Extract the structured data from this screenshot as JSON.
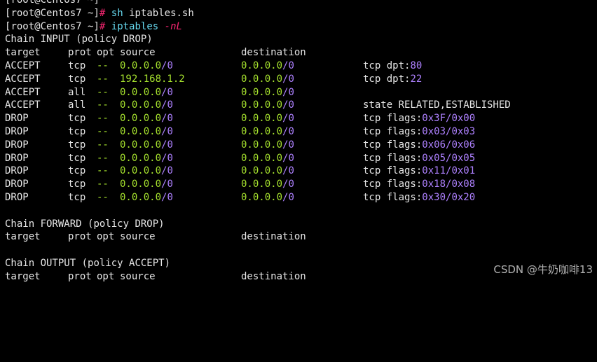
{
  "prompt1": {
    "open": "[",
    "userhost": "root@Centos7",
    "path": " ~",
    "close": "]",
    "hash": "#",
    "cmd": "sh",
    "arg": "iptables.sh"
  },
  "prompt2": {
    "open": "[",
    "userhost": "root@Centos7",
    "path": " ~",
    "close": "]",
    "hash": "#",
    "cmd": "iptables",
    "arg": "-nL"
  },
  "chains": {
    "input": {
      "title": "Chain INPUT",
      "policy": "(policy DROP)",
      "header": {
        "target": "target",
        "prot": "prot",
        "opt": "opt",
        "source": "source",
        "destination": "destination"
      },
      "rules": [
        {
          "target": "ACCEPT",
          "prot": "tcp",
          "opt": "--",
          "src_ip": "0.0.0.0",
          "src_mask": "/0",
          "dst_ip": "0.0.0.0",
          "dst_mask": "/0",
          "extra_a": "tcp dpt:",
          "extra_b": "80"
        },
        {
          "target": "ACCEPT",
          "prot": "tcp",
          "opt": "--",
          "src_ip": "192.168.1.2",
          "src_mask": "",
          "dst_ip": "0.0.0.0",
          "dst_mask": "/0",
          "extra_a": "tcp dpt:",
          "extra_b": "22"
        },
        {
          "target": "ACCEPT",
          "prot": "all",
          "opt": "--",
          "src_ip": "0.0.0.0",
          "src_mask": "/0",
          "dst_ip": "0.0.0.0",
          "dst_mask": "/0",
          "extra_a": "",
          "extra_b": ""
        },
        {
          "target": "ACCEPT",
          "prot": "all",
          "opt": "--",
          "src_ip": "0.0.0.0",
          "src_mask": "/0",
          "dst_ip": "0.0.0.0",
          "dst_mask": "/0",
          "extra_a": "state RELATED,ESTABLISHED",
          "extra_b": ""
        },
        {
          "target": "DROP",
          "prot": "tcp",
          "opt": "--",
          "src_ip": "0.0.0.0",
          "src_mask": "/0",
          "dst_ip": "0.0.0.0",
          "dst_mask": "/0",
          "extra_a": "tcp flags:",
          "extra_b": "0x3F/0x00"
        },
        {
          "target": "DROP",
          "prot": "tcp",
          "opt": "--",
          "src_ip": "0.0.0.0",
          "src_mask": "/0",
          "dst_ip": "0.0.0.0",
          "dst_mask": "/0",
          "extra_a": "tcp flags:",
          "extra_b": "0x03/0x03"
        },
        {
          "target": "DROP",
          "prot": "tcp",
          "opt": "--",
          "src_ip": "0.0.0.0",
          "src_mask": "/0",
          "dst_ip": "0.0.0.0",
          "dst_mask": "/0",
          "extra_a": "tcp flags:",
          "extra_b": "0x06/0x06"
        },
        {
          "target": "DROP",
          "prot": "tcp",
          "opt": "--",
          "src_ip": "0.0.0.0",
          "src_mask": "/0",
          "dst_ip": "0.0.0.0",
          "dst_mask": "/0",
          "extra_a": "tcp flags:",
          "extra_b": "0x05/0x05"
        },
        {
          "target": "DROP",
          "prot": "tcp",
          "opt": "--",
          "src_ip": "0.0.0.0",
          "src_mask": "/0",
          "dst_ip": "0.0.0.0",
          "dst_mask": "/0",
          "extra_a": "tcp flags:",
          "extra_b": "0x11/0x01"
        },
        {
          "target": "DROP",
          "prot": "tcp",
          "opt": "--",
          "src_ip": "0.0.0.0",
          "src_mask": "/0",
          "dst_ip": "0.0.0.0",
          "dst_mask": "/0",
          "extra_a": "tcp flags:",
          "extra_b": "0x18/0x08"
        },
        {
          "target": "DROP",
          "prot": "tcp",
          "opt": "--",
          "src_ip": "0.0.0.0",
          "src_mask": "/0",
          "dst_ip": "0.0.0.0",
          "dst_mask": "/0",
          "extra_a": "tcp flags:",
          "extra_b": "0x30/0x20"
        }
      ]
    },
    "forward": {
      "title": "Chain FORWARD",
      "policy": "(policy DROP)",
      "header": {
        "target": "target",
        "prot": "prot",
        "opt": "opt",
        "source": "source",
        "destination": "destination"
      }
    },
    "output": {
      "title": "Chain OUTPUT",
      "policy": "(policy ACCEPT)",
      "header": {
        "target": "target",
        "prot": "prot",
        "opt": "opt",
        "source": "source",
        "destination": "destination"
      }
    }
  },
  "watermark": "CSDN @牛奶咖啡13",
  "colors": {
    "background": "#000000",
    "text": "#e6e6e6",
    "ip_green": "#a6e22e",
    "mask_purple": "#ae81ff",
    "command_cyan": "#66d9ef",
    "hash_red": "#f92672"
  }
}
